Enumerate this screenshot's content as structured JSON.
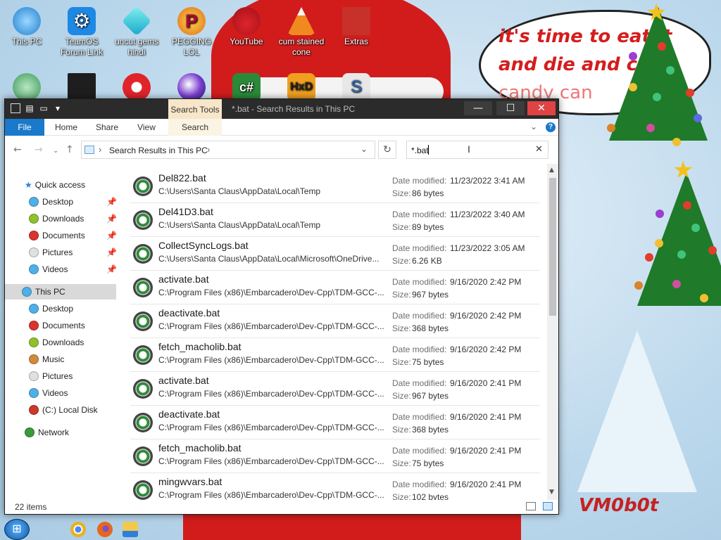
{
  "desktop": {
    "icons": [
      {
        "label": "This PC"
      },
      {
        "label": "TeamOS Forum Link"
      },
      {
        "label": "uncut gems hindi"
      },
      {
        "label": "PEGGING LOL"
      },
      {
        "label": "YouTube"
      },
      {
        "label": "cum stained cone"
      },
      {
        "label": "Extras"
      }
    ],
    "wallpaper_text": {
      "line1": "it's time to eat it",
      "line2": "and die and c",
      "line3": "candy can",
      "signature": "VM0b0t"
    }
  },
  "window": {
    "title": "*.bat - Search Results in This PC",
    "context_tab": "Search Tools",
    "ribbon_tabs": [
      "File",
      "Home",
      "Share",
      "View",
      "Search"
    ],
    "address": {
      "crumb": "Search Results in This PC"
    },
    "search": {
      "value": "*.bat"
    },
    "status": {
      "count": "22 items"
    }
  },
  "nav_pane": {
    "items": [
      {
        "label": "Quick access",
        "icon": "star-icon",
        "color": "#2f7fd8"
      },
      {
        "label": "Desktop",
        "icon": "desktop-icon",
        "color": "#4fb0e8",
        "pinned": true
      },
      {
        "label": "Downloads",
        "icon": "downloads-icon",
        "color": "#8fc12c",
        "pinned": true
      },
      {
        "label": "Documents",
        "icon": "documents-icon",
        "color": "#d9352e",
        "pinned": true
      },
      {
        "label": "Pictures",
        "icon": "pictures-icon",
        "color": "#e0e0e0",
        "pinned": true
      },
      {
        "label": "Videos",
        "icon": "videos-icon",
        "color": "#4fb0e8",
        "pinned": true
      },
      {
        "label": "This PC",
        "icon": "this-pc-icon",
        "color": "#4fb0e8",
        "selected": true
      },
      {
        "label": "Desktop",
        "icon": "desktop-icon",
        "color": "#4fb0e8"
      },
      {
        "label": "Documents",
        "icon": "documents-icon",
        "color": "#d9352e"
      },
      {
        "label": "Downloads",
        "icon": "downloads-icon",
        "color": "#8fc12c"
      },
      {
        "label": "Music",
        "icon": "music-icon",
        "color": "#d08a3c"
      },
      {
        "label": "Pictures",
        "icon": "pictures-icon",
        "color": "#e0e0e0"
      },
      {
        "label": "Videos",
        "icon": "videos-icon",
        "color": "#4fb0e8"
      },
      {
        "label": "(C:) Local Disk",
        "icon": "disk-icon",
        "color": "#c83a2a"
      },
      {
        "label": "Network",
        "icon": "network-icon",
        "color": "#3a9a3a"
      }
    ]
  },
  "results": {
    "date_label": "Date modified:",
    "size_label": "Size:",
    "rows": [
      {
        "name": "Del822.bat",
        "path": "C:\\Users\\Santa Claus\\AppData\\Local\\Temp",
        "date": "11/23/2022 3:41 AM",
        "size": "86 bytes"
      },
      {
        "name": "Del41D3.bat",
        "path": "C:\\Users\\Santa Claus\\AppData\\Local\\Temp",
        "date": "11/23/2022 3:40 AM",
        "size": "89 bytes"
      },
      {
        "name": "CollectSyncLogs.bat",
        "path": "C:\\Users\\Santa Claus\\AppData\\Local\\Microsoft\\OneDrive...",
        "date": "11/23/2022 3:05 AM",
        "size": "6.26 KB"
      },
      {
        "name": "activate.bat",
        "path": "C:\\Program Files (x86)\\Embarcadero\\Dev-Cpp\\TDM-GCC-...",
        "date": "9/16/2020 2:42 PM",
        "size": "967 bytes"
      },
      {
        "name": "deactivate.bat",
        "path": "C:\\Program Files (x86)\\Embarcadero\\Dev-Cpp\\TDM-GCC-...",
        "date": "9/16/2020 2:42 PM",
        "size": "368 bytes"
      },
      {
        "name": "fetch_macholib.bat",
        "path": "C:\\Program Files (x86)\\Embarcadero\\Dev-Cpp\\TDM-GCC-...",
        "date": "9/16/2020 2:42 PM",
        "size": "75 bytes"
      },
      {
        "name": "activate.bat",
        "path": "C:\\Program Files (x86)\\Embarcadero\\Dev-Cpp\\TDM-GCC-...",
        "date": "9/16/2020 2:41 PM",
        "size": "967 bytes"
      },
      {
        "name": "deactivate.bat",
        "path": "C:\\Program Files (x86)\\Embarcadero\\Dev-Cpp\\TDM-GCC-...",
        "date": "9/16/2020 2:41 PM",
        "size": "368 bytes"
      },
      {
        "name": "fetch_macholib.bat",
        "path": "C:\\Program Files (x86)\\Embarcadero\\Dev-Cpp\\TDM-GCC-...",
        "date": "9/16/2020 2:41 PM",
        "size": "75 bytes"
      },
      {
        "name": "mingwvars.bat",
        "path": "C:\\Program Files (x86)\\Embarcadero\\Dev-Cpp\\TDM-GCC-...",
        "date": "9/16/2020 2:41 PM",
        "size": "102 bytes"
      }
    ]
  },
  "taskbar": {
    "apps": [
      {
        "icon": "chrome-icon",
        "color": "#e8b21c"
      },
      {
        "icon": "firefox-icon",
        "color": "#e8661c"
      },
      {
        "icon": "file-explorer-icon",
        "color": "#f2c94c"
      }
    ]
  }
}
